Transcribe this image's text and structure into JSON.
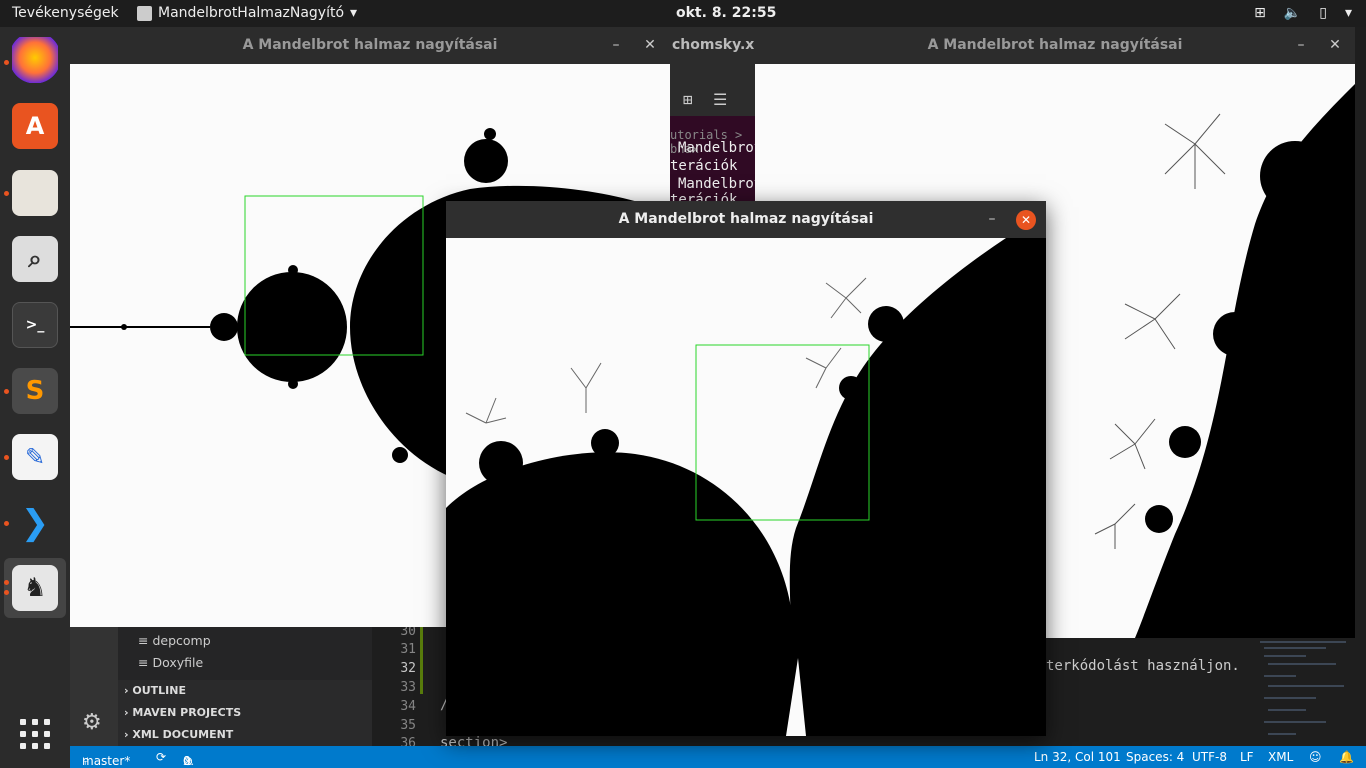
{
  "topbar": {
    "activities": "Tevékenységek",
    "app_name": "MandelbrotHalmazNagyító",
    "clock": "okt. 8.  22:55"
  },
  "terminal": {
    "tab_title": "chomsky.xml",
    "breadcrumb": "utorials > bhax",
    "lines": [
      "Mandelbrot",
      "terációk",
      "Mandelbrot",
      "terációk"
    ]
  },
  "windows": {
    "left_title": "A Mandelbrot halmaz nagyításai",
    "right_title": "A Mandelbrot halmaz nagyításai",
    "front_title": "A Mandelbrot halmaz nagyításai"
  },
  "vscode": {
    "files": [
      "depcomp",
      "Doxyfile"
    ],
    "sections": [
      "OUTLINE",
      "MAVEN PROJECTS",
      "XML DOCUMENT"
    ],
    "line_numbers": [
      "30",
      "31",
      "32",
      "33",
      "34",
      "35",
      "36"
    ],
    "code_right": "terkódolást használjon.",
    "code_bottom": "section>",
    "code_slash": "/"
  },
  "statusbar": {
    "branch": "master*",
    "errors": "0",
    "warnings": "0",
    "position": "Ln 32, Col 101",
    "spaces": "Spaces: 4",
    "encoding": "UTF-8",
    "eol": "LF",
    "language": "XML"
  },
  "icons": [
    "firefox-icon",
    "software-icon",
    "files-icon",
    "search-tool-icon",
    "terminal-icon",
    "sublime-icon",
    "text-editor-icon",
    "vscode-icon",
    "java-icon",
    "apps-grid-icon"
  ]
}
